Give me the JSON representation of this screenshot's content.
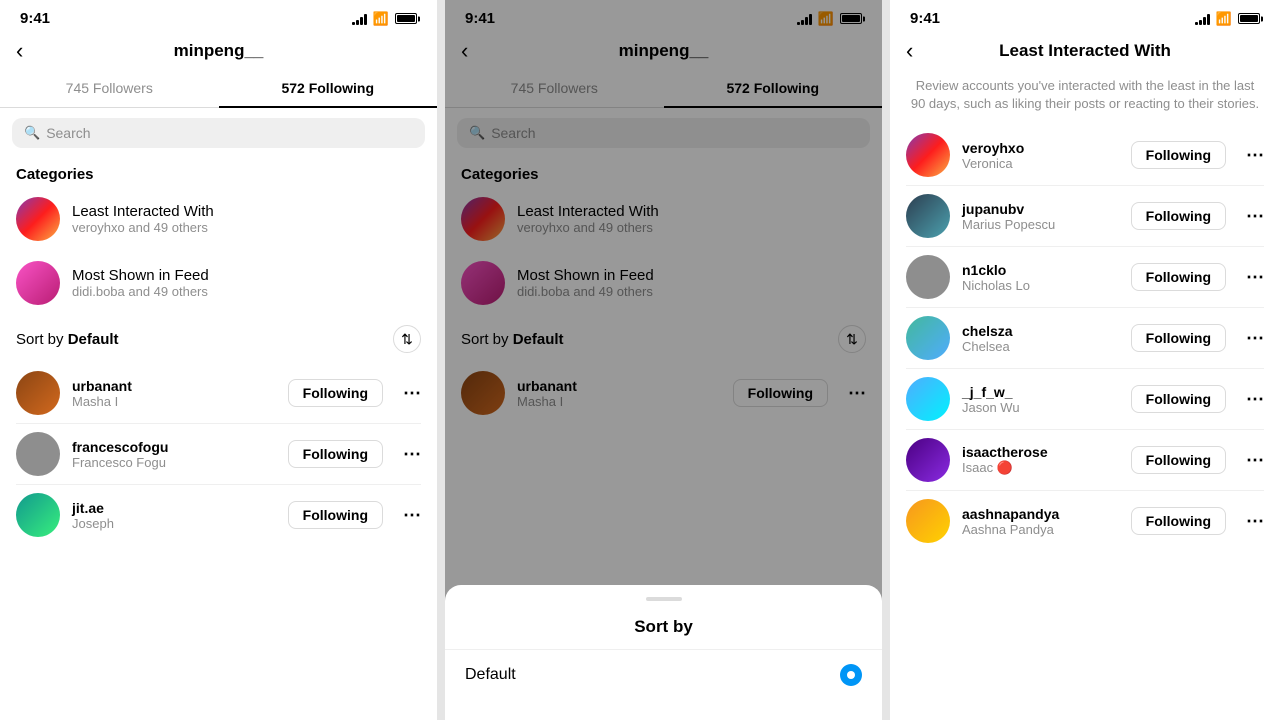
{
  "left": {
    "status_time": "9:41",
    "header_title": "minpeng__",
    "tab_followers": "745 Followers",
    "tab_following": "572 Following",
    "search_placeholder": "Search",
    "categories_heading": "Categories",
    "categories": [
      {
        "title": "Least Interacted With",
        "sub": "veroyhxo and 49 others",
        "av_class": "av-purple"
      },
      {
        "title": "Most Shown in Feed",
        "sub": "didi.boba and 49 others",
        "av_class": "av-pink"
      }
    ],
    "sort_label": "Sort by",
    "sort_value": "Default",
    "users": [
      {
        "username": "urbanant",
        "fullname": "Masha I",
        "av_class": "av-brown"
      },
      {
        "username": "francescofogu",
        "fullname": "Francesco Fogu",
        "av_class": "av-gray"
      },
      {
        "username": "jit.ae",
        "fullname": "Joseph",
        "av_class": "av-green"
      }
    ],
    "follow_label": "Following"
  },
  "middle": {
    "status_time": "9:41",
    "header_title": "minpeng__",
    "tab_followers": "745 Followers",
    "tab_following": "572 Following",
    "search_placeholder": "Search",
    "categories_heading": "Categories",
    "categories": [
      {
        "title": "Least Interacted With",
        "sub": "veroyhxo and 49 others",
        "av_class": "av-purple"
      },
      {
        "title": "Most Shown in Feed",
        "sub": "didi.boba and 49 others",
        "av_class": "av-pink"
      }
    ],
    "sort_label": "Sort by",
    "sort_value": "Default",
    "users": [
      {
        "username": "urbanant",
        "fullname": "Masha I",
        "av_class": "av-brown"
      }
    ],
    "follow_label": "Following",
    "sheet_title": "Sort by",
    "sheet_options": [
      {
        "label": "Default",
        "selected": true
      }
    ]
  },
  "right": {
    "status_time": "9:41",
    "header_title": "Least Interacted With",
    "subtitle": "Review accounts you've interacted with the least in the last 90 days, such as liking their posts or reacting to their stories.",
    "users": [
      {
        "username": "veroyhxo",
        "fullname": "Veronica",
        "av_class": "av-purple"
      },
      {
        "username": "jupanubv",
        "fullname": "Marius Popescu",
        "av_class": "av-darkblue"
      },
      {
        "username": "n1cklo",
        "fullname": "Nicholas Lo",
        "av_class": "av-gray"
      },
      {
        "username": "chelsza",
        "fullname": "Chelsea",
        "av_class": "av-teal"
      },
      {
        "username": "_j_f_w_",
        "fullname": "Jason Wu",
        "av_class": "av-blue"
      },
      {
        "username": "isaactherose",
        "fullname": "Isaac 🔴",
        "av_class": "av-indigo"
      },
      {
        "username": "aashnapandya",
        "fullname": "Aashna Pandya",
        "av_class": "av-orange"
      }
    ],
    "follow_label": "Following"
  }
}
